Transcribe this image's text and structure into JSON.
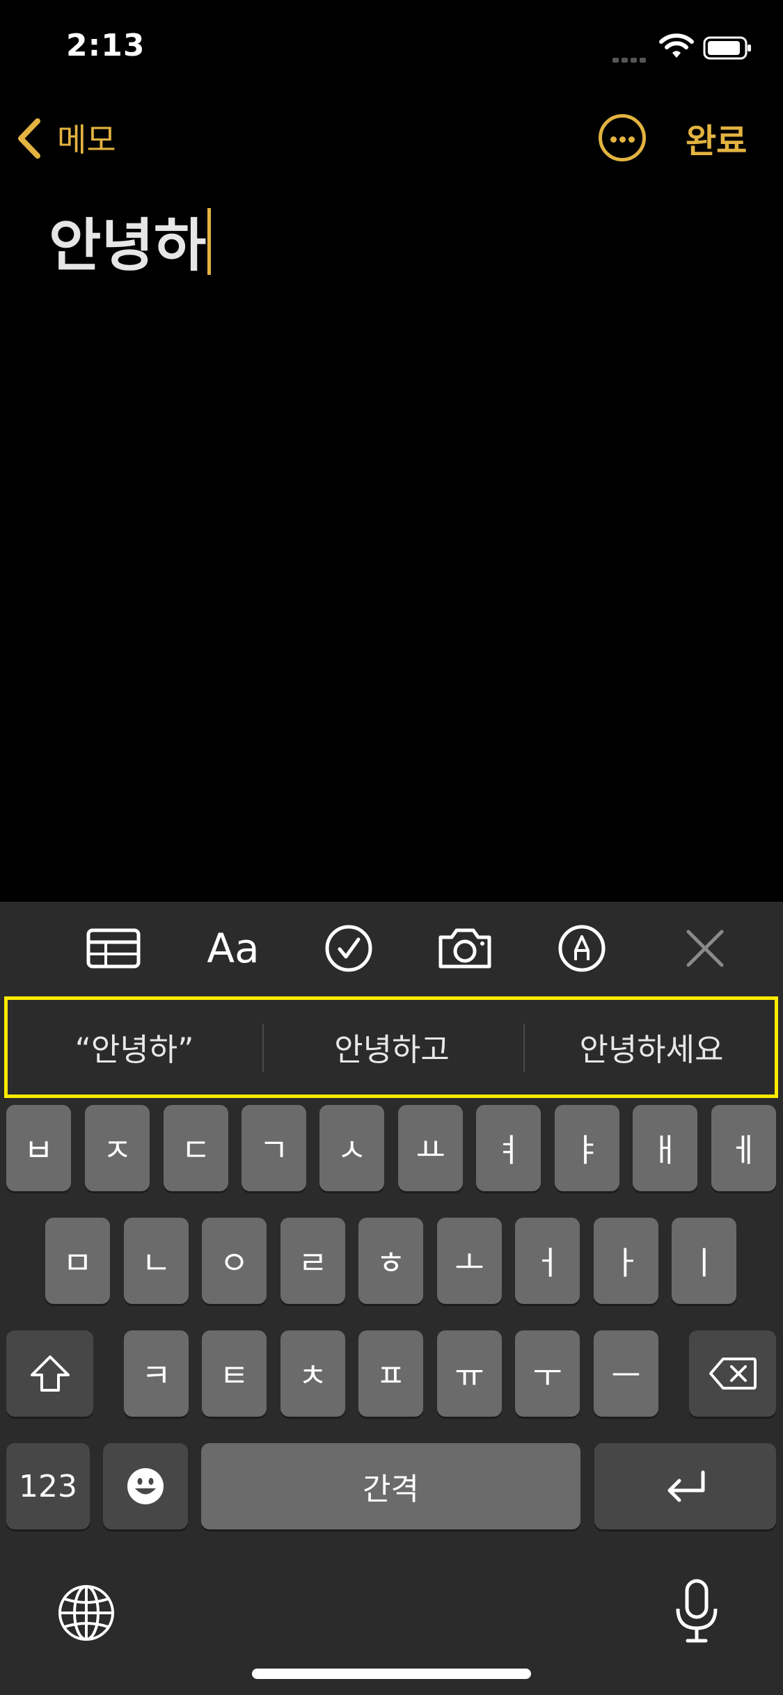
{
  "status_bar": {
    "time": "2:13"
  },
  "nav": {
    "back_label": "메모",
    "done_label": "완료"
  },
  "note": {
    "text": "안녕하"
  },
  "toolbar": {
    "format_label": "Aa",
    "icons": [
      "table-icon",
      "format-icon",
      "checklist-icon",
      "camera-icon",
      "markup-icon",
      "close-icon"
    ]
  },
  "suggestions": [
    "“안녕하”",
    "안녕하고",
    "안녕하세요"
  ],
  "keyboard": {
    "row1": [
      "ㅂ",
      "ㅈ",
      "ㄷ",
      "ㄱ",
      "ㅅ",
      "ㅛ",
      "ㅕ",
      "ㅑ",
      "ㅐ",
      "ㅔ"
    ],
    "row2": [
      "ㅁ",
      "ㄴ",
      "ㅇ",
      "ㄹ",
      "ㅎ",
      "ㅗ",
      "ㅓ",
      "ㅏ",
      "ㅣ"
    ],
    "row3": [
      "ㅋ",
      "ㅌ",
      "ㅊ",
      "ㅍ",
      "ㅠ",
      "ㅜ",
      "ㅡ"
    ],
    "numbers_label": "123",
    "space_label": "간격"
  },
  "colors": {
    "accent": "#E3B341",
    "highlight": "#FFEB00",
    "background": "#000000",
    "keyboard_bg": "#2B2B2B",
    "key": "#6B6B6B"
  }
}
